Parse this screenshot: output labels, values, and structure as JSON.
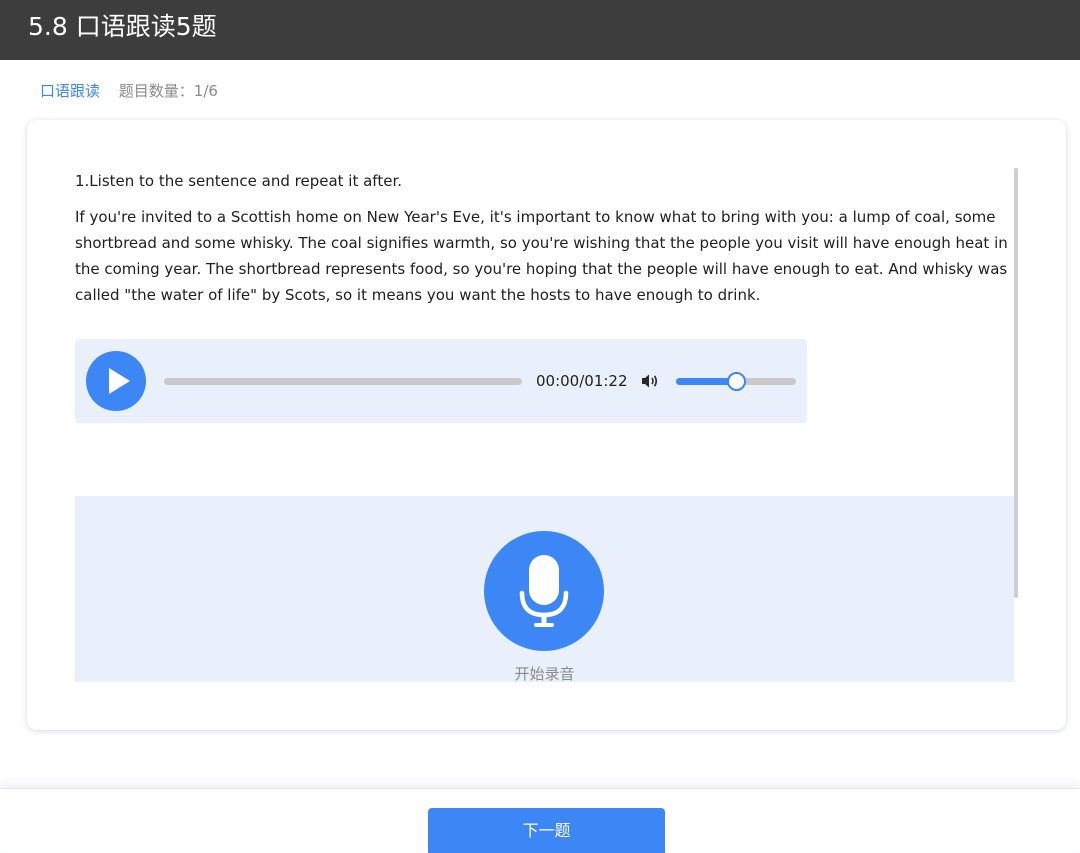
{
  "header": {
    "title": "5.8 口语跟读5题"
  },
  "breadcrumb": {
    "tab": "口语跟读",
    "count": "题目数量：1/6"
  },
  "question": {
    "title": "1.Listen to the sentence and repeat it after.",
    "passage": "If you're invited to a Scottish home on New Year's Eve, it's important to know what to bring with you: a lump of coal, some shortbread and some whisky. The coal signifies warmth, so you're wishing that the people you visit will have enough heat in the coming year. The shortbread represents food, so you're hoping that the people will have enough to eat. And whisky was called \"the water of life\" by Scots, so it means you want the hosts to have enough to drink."
  },
  "audio": {
    "time": "00:00/01:22",
    "progress": 0,
    "volume": 0.5
  },
  "recorder": {
    "label": "开始录音"
  },
  "footer": {
    "next_label": "下一题"
  },
  "colors": {
    "accent": "#3d86f5",
    "header_bg": "#3d3d3d",
    "panel_bg": "#e9f0fb"
  },
  "icons": {
    "play": "play-icon",
    "volume": "volume-icon",
    "mic": "microphone-icon"
  }
}
